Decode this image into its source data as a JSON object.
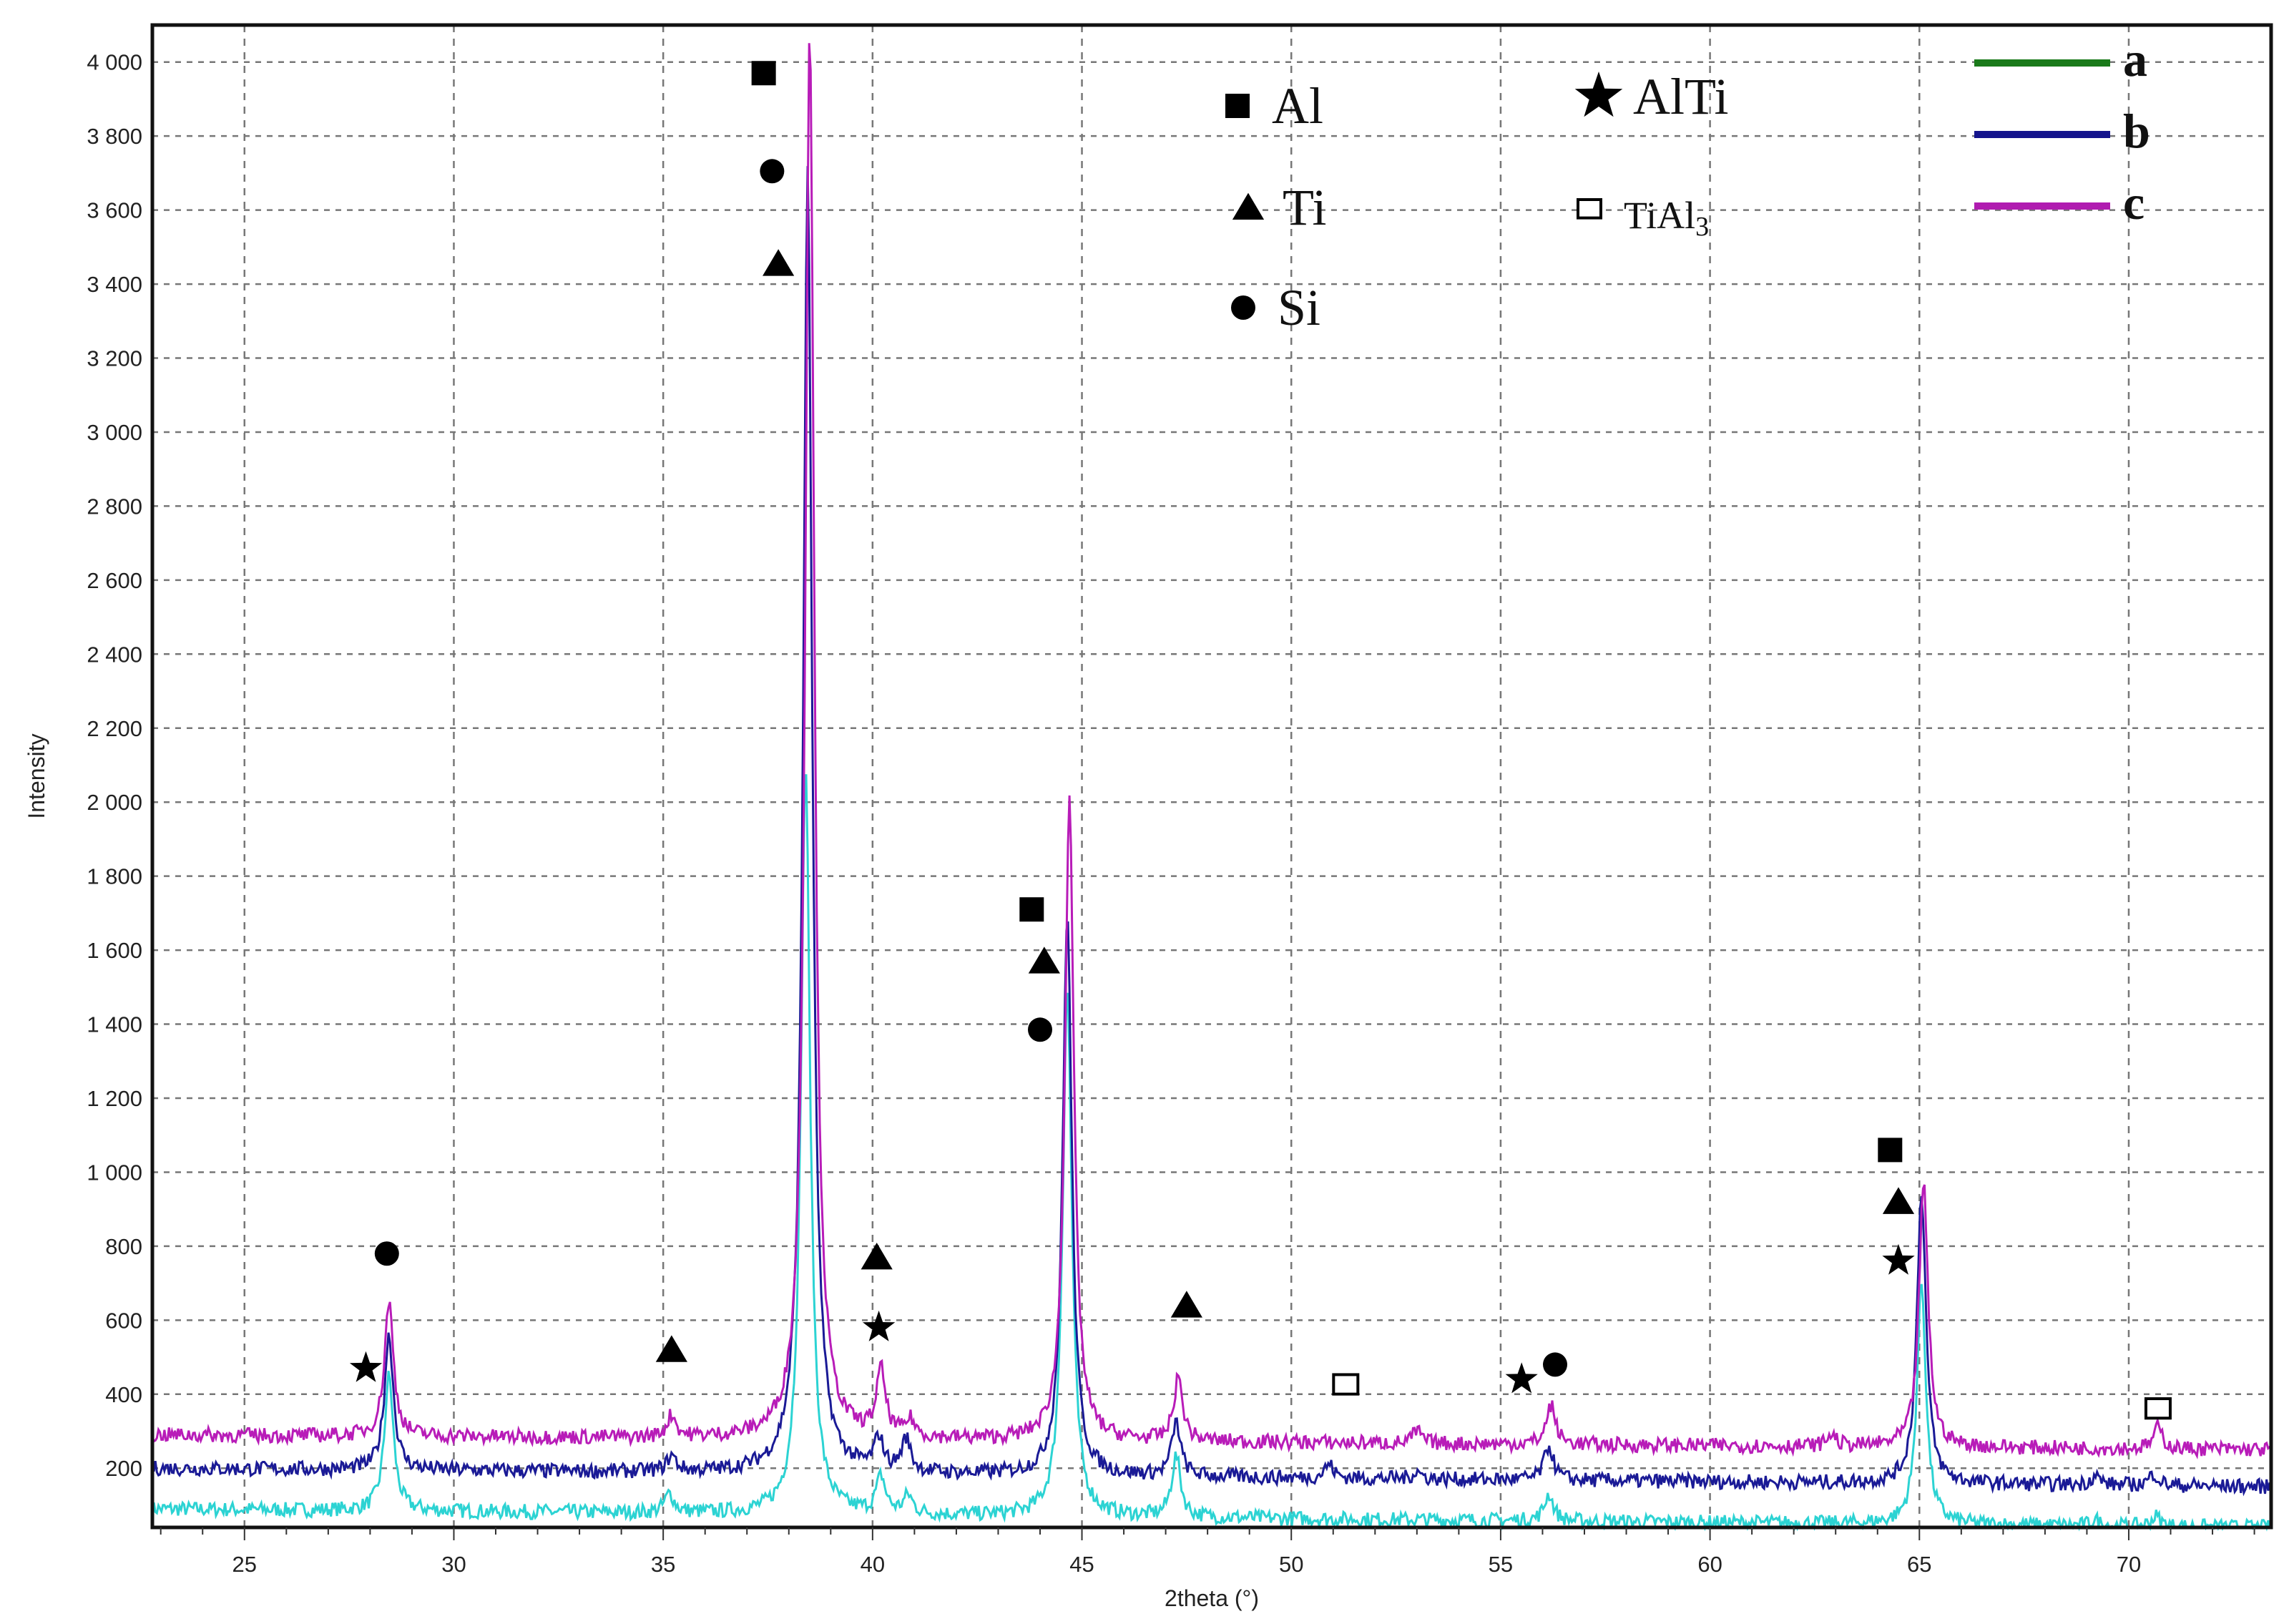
{
  "chart_data": {
    "type": "line",
    "title": "",
    "xlabel": "2theta (°)",
    "ylabel": "Intensity",
    "xlim": [
      22.8,
      73.4
    ],
    "ylim": [
      40,
      4100
    ],
    "xticks": [
      25,
      30,
      35,
      40,
      45,
      50,
      55,
      60,
      65,
      70
    ],
    "yticks": [
      200,
      400,
      600,
      800,
      1000,
      1200,
      1400,
      1600,
      1800,
      2000,
      2200,
      2400,
      2600,
      2800,
      3000,
      3200,
      3400,
      3600,
      3800,
      4000
    ],
    "ytick_labels": [
      "200",
      "400",
      "600",
      "800",
      "1 000",
      "1 200",
      "1 400",
      "1 600",
      "1 800",
      "2 000",
      "2 200",
      "2 400",
      "2 600",
      "2 800",
      "3 000",
      "3 200",
      "3 400",
      "3 600",
      "3 800",
      "4 000"
    ],
    "grid": true,
    "legend_position": "top-right",
    "series": [
      {
        "name": "a",
        "legend_color": "#1a7a1a",
        "line_color": "#2cd3d3",
        "baseline_start": 90,
        "baseline_end": 40,
        "peaks": [
          [
            28.45,
            450
          ],
          [
            35.15,
            130
          ],
          [
            38.4,
            2100
          ],
          [
            40.2,
            170
          ],
          [
            40.85,
            120
          ],
          [
            44.65,
            1500
          ],
          [
            47.25,
            230
          ],
          [
            56.15,
            130
          ],
          [
            65.05,
            700
          ],
          [
            69.2,
            60
          ],
          [
            70.65,
            70
          ]
        ]
      },
      {
        "name": "b",
        "legend_color": "#14148c",
        "line_color": "#1a1a96",
        "baseline_start": 200,
        "baseline_end": 150,
        "peaks": [
          [
            28.45,
            560
          ],
          [
            35.2,
            230
          ],
          [
            38.45,
            3700
          ],
          [
            40.15,
            270
          ],
          [
            40.8,
            270
          ],
          [
            44.65,
            1700
          ],
          [
            47.25,
            320
          ],
          [
            50.9,
            210
          ],
          [
            53.0,
            190
          ],
          [
            56.15,
            260
          ],
          [
            65.05,
            950
          ],
          [
            69.2,
            180
          ],
          [
            70.6,
            185
          ]
        ]
      },
      {
        "name": "c",
        "legend_color": "#b01cb0",
        "line_color": "#b81cb8",
        "baseline_start": 290,
        "baseline_end": 250,
        "peaks": [
          [
            28.45,
            650
          ],
          [
            35.2,
            340
          ],
          [
            38.5,
            4100
          ],
          [
            40.2,
            450
          ],
          [
            40.9,
            320
          ],
          [
            44.7,
            2000
          ],
          [
            47.3,
            440
          ],
          [
            53.0,
            300
          ],
          [
            56.2,
            370
          ],
          [
            62.9,
            290
          ],
          [
            65.1,
            970
          ],
          [
            70.7,
            310
          ]
        ]
      }
    ],
    "phase_key": [
      {
        "symbol": "square",
        "label": "Al"
      },
      {
        "symbol": "triangle",
        "label": "Ti"
      },
      {
        "symbol": "circle",
        "label": "Si"
      },
      {
        "symbol": "star",
        "label": "AlTi"
      },
      {
        "symbol": "open-square",
        "label": "TiAl",
        "label_sub": "3"
      }
    ],
    "annotations": [
      {
        "symbol": "square",
        "x": 37.4,
        "y": 3970
      },
      {
        "symbol": "circle",
        "x": 37.6,
        "y": 3705
      },
      {
        "symbol": "triangle",
        "x": 37.75,
        "y": 3455
      },
      {
        "symbol": "circle",
        "x": 28.4,
        "y": 780
      },
      {
        "symbol": "star",
        "x": 27.9,
        "y": 470
      },
      {
        "symbol": "triangle",
        "x": 35.2,
        "y": 520
      },
      {
        "symbol": "triangle",
        "x": 40.1,
        "y": 770
      },
      {
        "symbol": "star",
        "x": 40.15,
        "y": 580
      },
      {
        "symbol": "square",
        "x": 43.8,
        "y": 1710
      },
      {
        "symbol": "triangle",
        "x": 44.1,
        "y": 1570
      },
      {
        "symbol": "circle",
        "x": 44.0,
        "y": 1385
      },
      {
        "symbol": "triangle",
        "x": 47.5,
        "y": 640
      },
      {
        "symbol": "open-square",
        "x": 51.3,
        "y": 420
      },
      {
        "symbol": "star",
        "x": 55.5,
        "y": 440
      },
      {
        "symbol": "circle",
        "x": 56.3,
        "y": 480
      },
      {
        "symbol": "square",
        "x": 64.3,
        "y": 1060
      },
      {
        "symbol": "triangle",
        "x": 64.5,
        "y": 920
      },
      {
        "symbol": "star",
        "x": 64.5,
        "y": 760
      },
      {
        "symbol": "open-square",
        "x": 70.7,
        "y": 355
      }
    ]
  }
}
